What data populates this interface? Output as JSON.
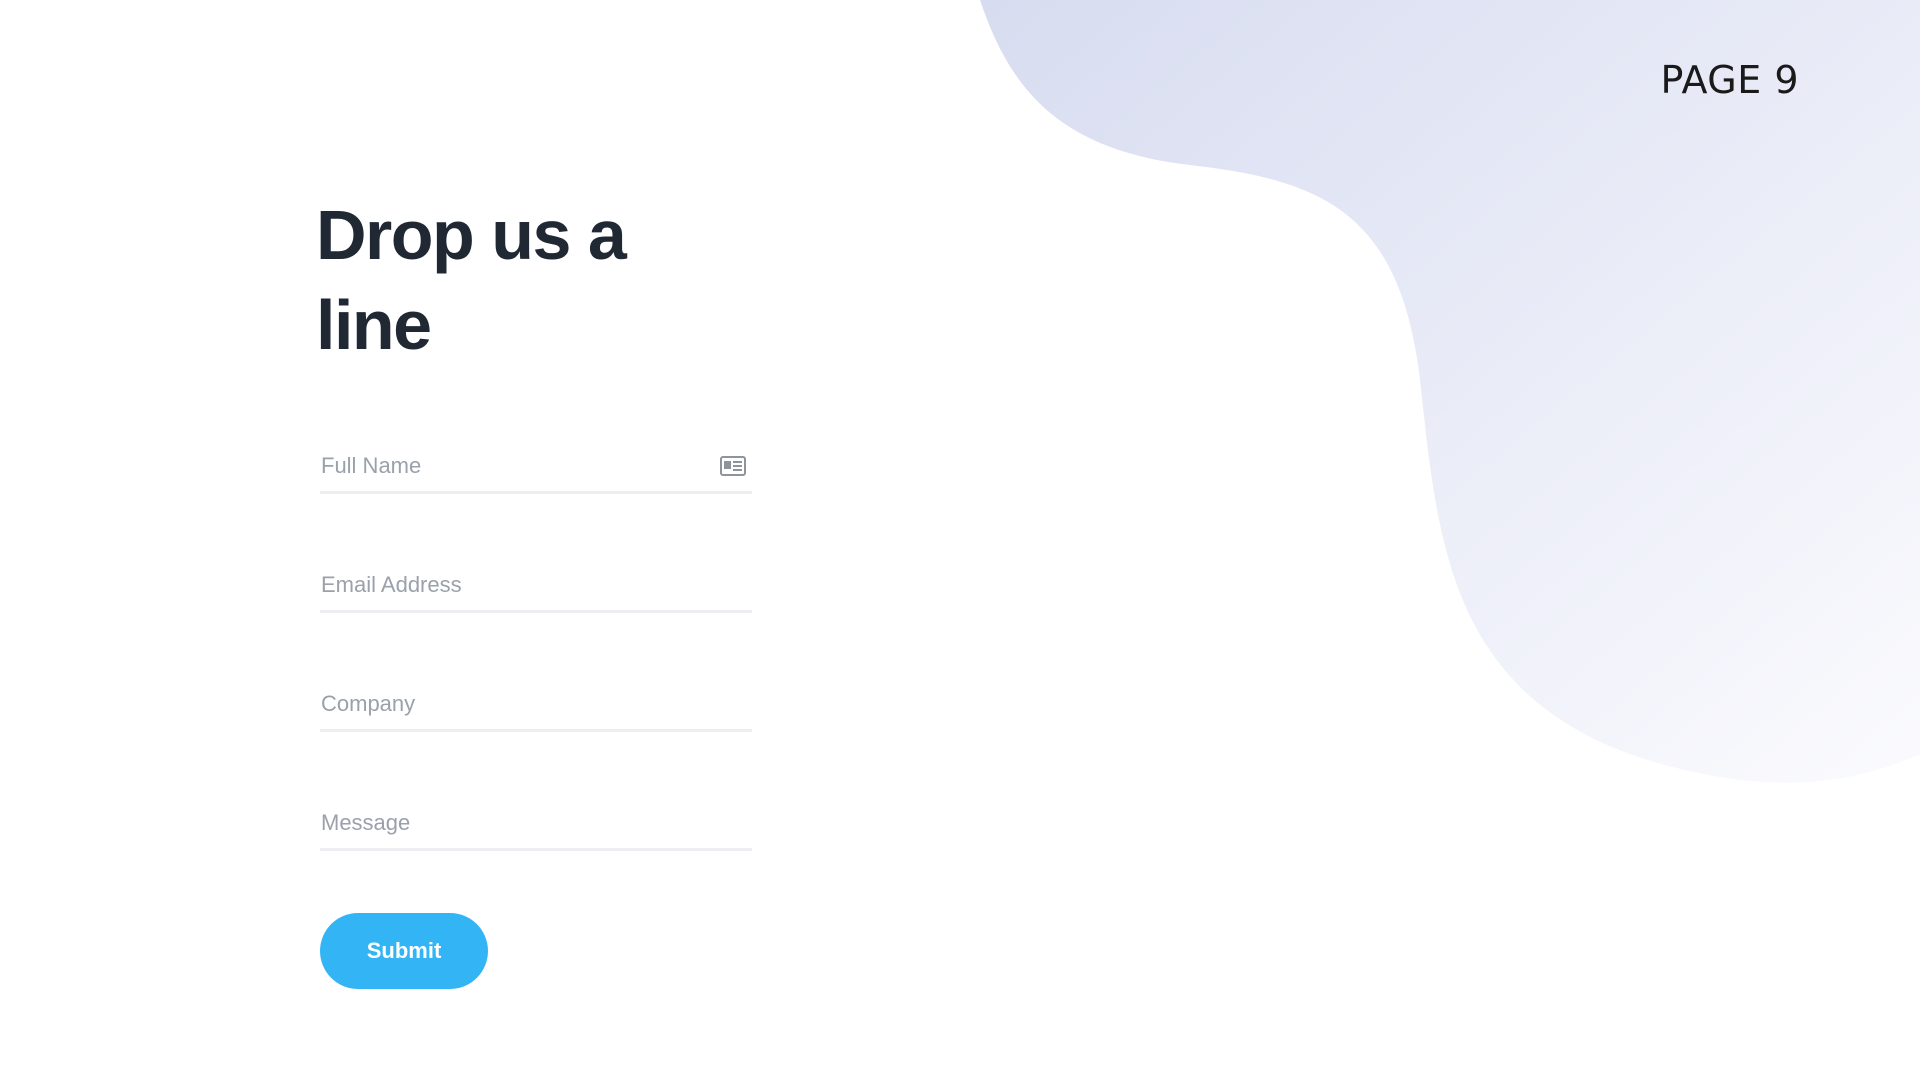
{
  "page": {
    "number_label": "PAGE 9"
  },
  "form": {
    "title": "Drop us a line",
    "fields": [
      {
        "placeholder": "Full Name",
        "value": ""
      },
      {
        "placeholder": "Email Address",
        "value": ""
      },
      {
        "placeholder": "Company",
        "value": ""
      },
      {
        "placeholder": "Message",
        "value": ""
      }
    ],
    "submit_label": "Submit"
  },
  "icons": {
    "full_name_field": "contact-card-icon"
  },
  "colors": {
    "accent": "#33b5f5",
    "title": "#1f2833",
    "placeholder": "#9aa1ab",
    "blob_start": "#d7dcf0",
    "blob_end": "#f7f8fd"
  }
}
